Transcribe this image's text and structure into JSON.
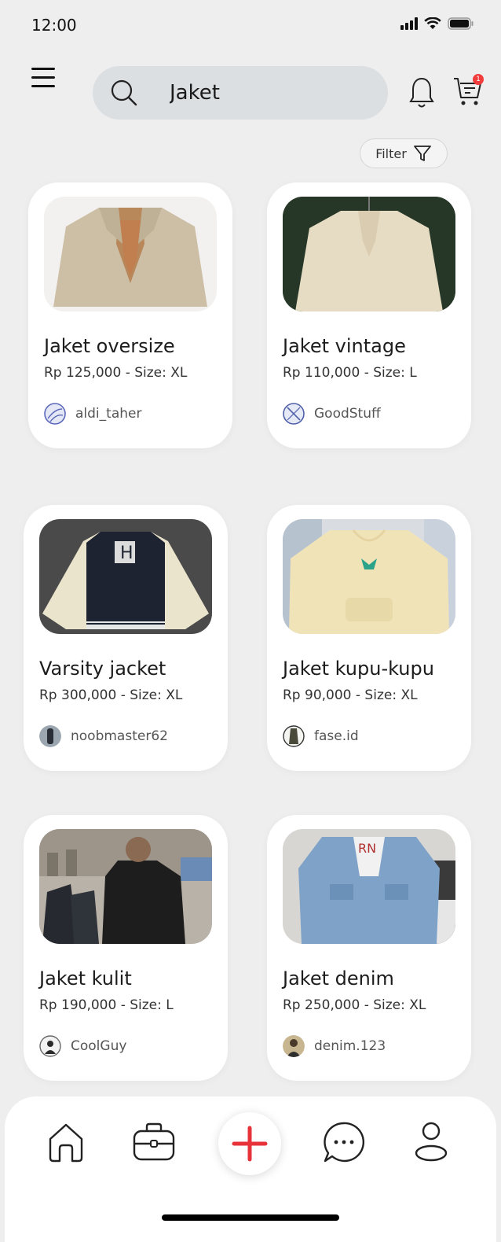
{
  "status_bar": {
    "time": "12:00"
  },
  "header": {
    "search": {
      "value": "Jaket",
      "placeholder": ""
    },
    "cart_badge": "1"
  },
  "filter": {
    "label": "Filter"
  },
  "products": [
    {
      "title": "Jaket oversize",
      "price": "Rp 125,000 - Size: XL",
      "seller": "aldi_taher"
    },
    {
      "title": "Jaket vintage",
      "price": "Rp 110,000 - Size: L",
      "seller": "GoodStuff"
    },
    {
      "title": "Varsity jacket",
      "price": "Rp 300,000 - Size: XL",
      "seller": "noobmaster62"
    },
    {
      "title": "Jaket kupu-kupu",
      "price": "Rp 90,000 - Size: XL",
      "seller": "fase.id"
    },
    {
      "title": "Jaket kulit",
      "price": "Rp 190,000 - Size: L",
      "seller": "CoolGuy"
    },
    {
      "title": "Jaket denim",
      "price": "Rp 250,000 - Size: XL",
      "seller": "denim.123"
    }
  ],
  "bottom_nav": {
    "items": [
      "home-icon",
      "briefcase-icon",
      "add-icon",
      "chat-icon",
      "profile-icon"
    ],
    "accent": "#e8323a"
  }
}
